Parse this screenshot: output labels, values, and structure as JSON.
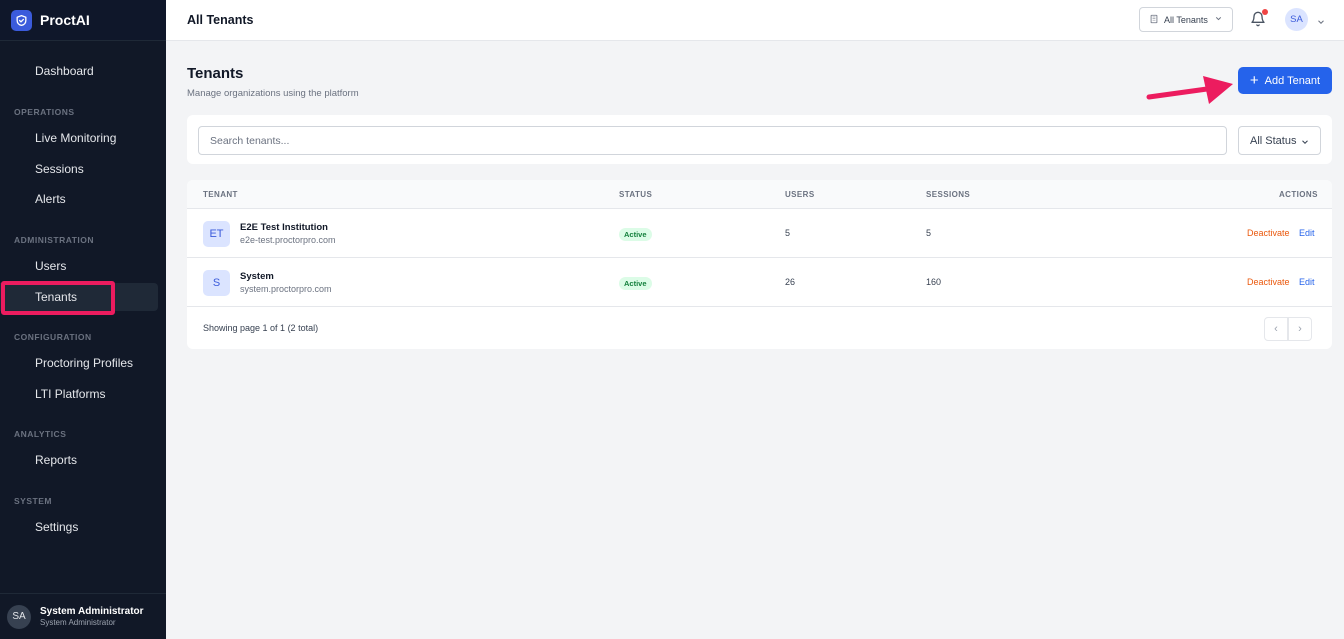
{
  "app": {
    "name": "ProctAI"
  },
  "sidebar": {
    "dashboard": "Dashboard",
    "sections": {
      "operations": "OPERATIONS",
      "administration": "ADMINISTRATION",
      "configuration": "CONFIGURATION",
      "analytics": "ANALYTICS",
      "system": "SYSTEM"
    },
    "items": {
      "live_monitoring": "Live Monitoring",
      "sessions": "Sessions",
      "alerts": "Alerts",
      "users": "Users",
      "tenants": "Tenants",
      "proctoring_profiles": "Proctoring Profiles",
      "lti_platforms": "LTI Platforms",
      "reports": "Reports",
      "settings": "Settings"
    },
    "active": "tenants",
    "user": {
      "initials": "SA",
      "name": "System Administrator",
      "role": "System Administrator"
    }
  },
  "header": {
    "title": "All Tenants",
    "tenant_selector": "All Tenants",
    "avatar_initials": "SA",
    "has_notification": true
  },
  "page": {
    "title": "Tenants",
    "subtitle": "Manage organizations using the platform",
    "add_button": "Add Tenant"
  },
  "filters": {
    "search_placeholder": "Search tenants...",
    "search_value": "",
    "status_selected": "All Status"
  },
  "table": {
    "columns": {
      "tenant": "TENANT",
      "status": "STATUS",
      "users": "USERS",
      "sessions": "SESSIONS",
      "actions": "ACTIONS"
    },
    "rows": [
      {
        "initials": "ET",
        "name": "E2E Test Institution",
        "domain": "e2e-test.proctorpro.com",
        "status": "Active",
        "users": "5",
        "sessions": "5",
        "deactivate": "Deactivate",
        "edit": "Edit"
      },
      {
        "initials": "S",
        "name": "System",
        "domain": "system.proctorpro.com",
        "status": "Active",
        "users": "26",
        "sessions": "160",
        "deactivate": "Deactivate",
        "edit": "Edit"
      }
    ],
    "footer": "Showing page 1 of 1 (2 total)",
    "prev": "‹",
    "next": "›"
  },
  "colors": {
    "sidebar_bg": "#111827",
    "accent": "#2563eb",
    "highlight": "#ec1c5f",
    "status_active": "#15803d",
    "deactivate": "#ea580c"
  }
}
